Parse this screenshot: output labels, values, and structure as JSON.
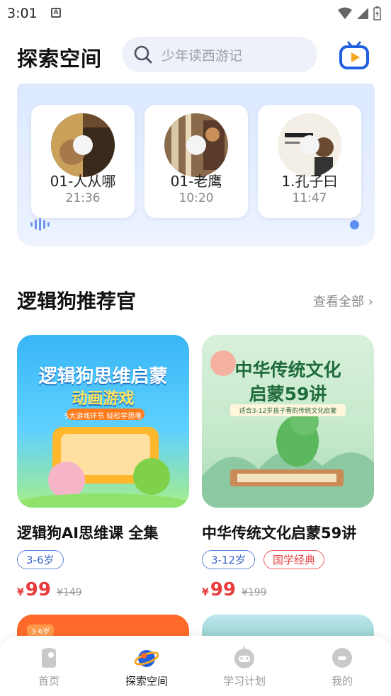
{
  "status": {
    "time": "3:01",
    "notif": "A"
  },
  "header": {
    "title": "探索空间",
    "search_placeholder": "少年读西游记"
  },
  "audio_tracks": [
    {
      "name": "01-人从哪",
      "duration": "21:36"
    },
    {
      "name": "01-老鹰",
      "duration": "10:20"
    },
    {
      "name": "1.孔子曰",
      "duration": "11:47"
    }
  ],
  "section": {
    "title": "逻辑狗推荐官",
    "see_all": "查看全部"
  },
  "products": [
    {
      "title": "逻辑狗AI思维课 全集",
      "tags": [
        "3-6岁"
      ],
      "yen": "¥",
      "price": "99",
      "orig": "¥149",
      "cover_title1": "逻辑狗思维启蒙",
      "cover_title2": "动画游戏",
      "cover_sub": "5大游戏环节  轻松学思维"
    },
    {
      "title": "中华传统文化启蒙59讲",
      "tags": [
        "3-12岁",
        "国学经典"
      ],
      "yen": "¥",
      "price": "99",
      "orig": "¥199",
      "cover_title1": "中华传统文化",
      "cover_title2": "启蒙59讲",
      "cover_sub": "适合3-12岁孩子看的传统文化启蒙"
    }
  ],
  "next_card_tag": "3-6岁",
  "tabs": [
    {
      "label": "首页",
      "icon": "home-icon"
    },
    {
      "label": "探索空间",
      "icon": "planet-icon"
    },
    {
      "label": "学习计划",
      "icon": "robot-icon"
    },
    {
      "label": "我的",
      "icon": "profile-icon"
    }
  ],
  "colors": {
    "accent": "#3b67c9",
    "price": "#e83a3a",
    "panel": "#dbe8ff"
  }
}
